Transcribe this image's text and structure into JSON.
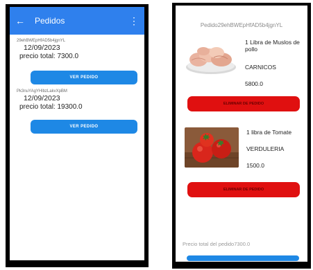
{
  "left_screen": {
    "appbar": {
      "back_icon": "arrow-left-icon",
      "title": "Pedidos",
      "more_icon": "more-vertical-icon"
    },
    "orders": [
      {
        "id": "29ehBWEpHfAD5b4jgnYL",
        "date": "12/09/2023",
        "total": "precio total: 7300.0",
        "button": "VER PEDIDO"
      },
      {
        "id": "Pk3nuYAgYHlbzLakvXpBM",
        "date": "12/09/2023",
        "total": "precio total: 19300.0",
        "button": "VER PEDIDO"
      }
    ]
  },
  "right_screen": {
    "header": "Pedido29ehBWEpHfAD5b4jgnYL",
    "items": [
      {
        "name": "1 Libra de Muslos de pollo",
        "category": "CARNICOS",
        "price": "5800.0",
        "button": "ELIMINAR DE PEDIDO"
      },
      {
        "name": "1 libra de Tomate",
        "category": "VERDULERIA",
        "price": "1500.0",
        "button": "ELIMINAR DE PEDIDO"
      }
    ],
    "order_total": "Precio total del pedido7300.0"
  },
  "colors": {
    "primary": "#1e88e5",
    "appbar": "#2f80ed",
    "danger": "#e01010"
  }
}
